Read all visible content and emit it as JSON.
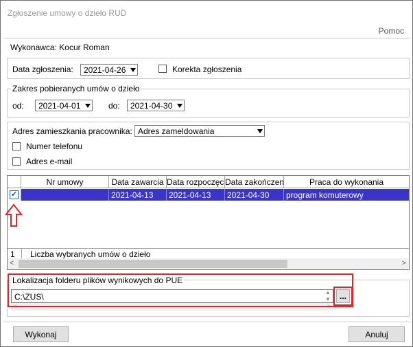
{
  "window": {
    "title": "Zgłoszenie umowy o dzieło RUD",
    "help_label": "Pomoc"
  },
  "contractor": {
    "label": "Wykonawca:",
    "name": "Kocur Roman"
  },
  "report": {
    "date_label": "Data zgłoszenia:",
    "date_value": "2021-04-26",
    "correction_label": "Korekta zgłoszenia",
    "correction_checked": false
  },
  "range": {
    "title": "Zakres pobieranych umów o dzieło",
    "from_label": "od:",
    "from_value": "2021-04-01",
    "to_label": "do:",
    "to_value": "2021-04-30"
  },
  "address": {
    "label": "Adres zamieszkania pracownika:",
    "value": "Adres zameldowania",
    "phone_label": "Numer telefonu",
    "email_label": "Adres e-mail"
  },
  "grid": {
    "columns": [
      "",
      "Nr umowy",
      "Data zawarcia",
      "Data rozpoczęci",
      "Data zakończeni",
      "Praca do wykonania"
    ],
    "rows": [
      {
        "checked": true,
        "nr": "",
        "zawarcia": "2021-04-13",
        "rozpoczecia": "2021-04-13",
        "zakonczenia": "2021-04-30",
        "praca": "program komuterowy"
      }
    ],
    "footer_count": "1",
    "footer_label": "Liczba wybranych umów o dzieło"
  },
  "output": {
    "title": "Lokalizacja folderu plików wynikowych do PUE",
    "path": "C:\\ZUS\\",
    "browse_label": "..."
  },
  "buttons": {
    "execute": "Wykonaj",
    "cancel": "Anuluj"
  },
  "colors": {
    "selection": "#3b34c8",
    "highlight": "#e0262b"
  }
}
